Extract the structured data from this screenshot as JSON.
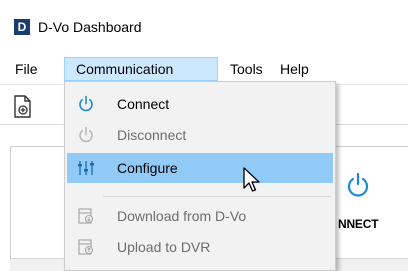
{
  "window": {
    "logo_letter": "D",
    "title": "D-Vo Dashboard"
  },
  "menubar": {
    "items": [
      {
        "label": "File"
      },
      {
        "label": "Communication",
        "open": true
      },
      {
        "label": "Tools"
      },
      {
        "label": "Help"
      }
    ]
  },
  "dropdown": {
    "items": [
      {
        "label": "Connect",
        "icon": "power-icon",
        "enabled": true,
        "highlighted": false
      },
      {
        "label": "Disconnect",
        "icon": "power-icon",
        "enabled": false,
        "highlighted": false
      },
      {
        "label": "Configure",
        "icon": "sliders-icon",
        "enabled": true,
        "highlighted": true
      },
      {
        "label": "Download from D-Vo",
        "icon": "download-icon",
        "enabled": false,
        "highlighted": false
      },
      {
        "label": "Upload to DVR",
        "icon": "upload-icon",
        "enabled": false,
        "highlighted": false
      }
    ]
  },
  "main": {
    "connect_label": "NNECT"
  },
  "colors": {
    "menu_open_bg": "#cce8ff",
    "item_highlight": "#91c9f7",
    "accent_blue": "#1a8ad4",
    "disabled_text": "#6d6d6d"
  }
}
